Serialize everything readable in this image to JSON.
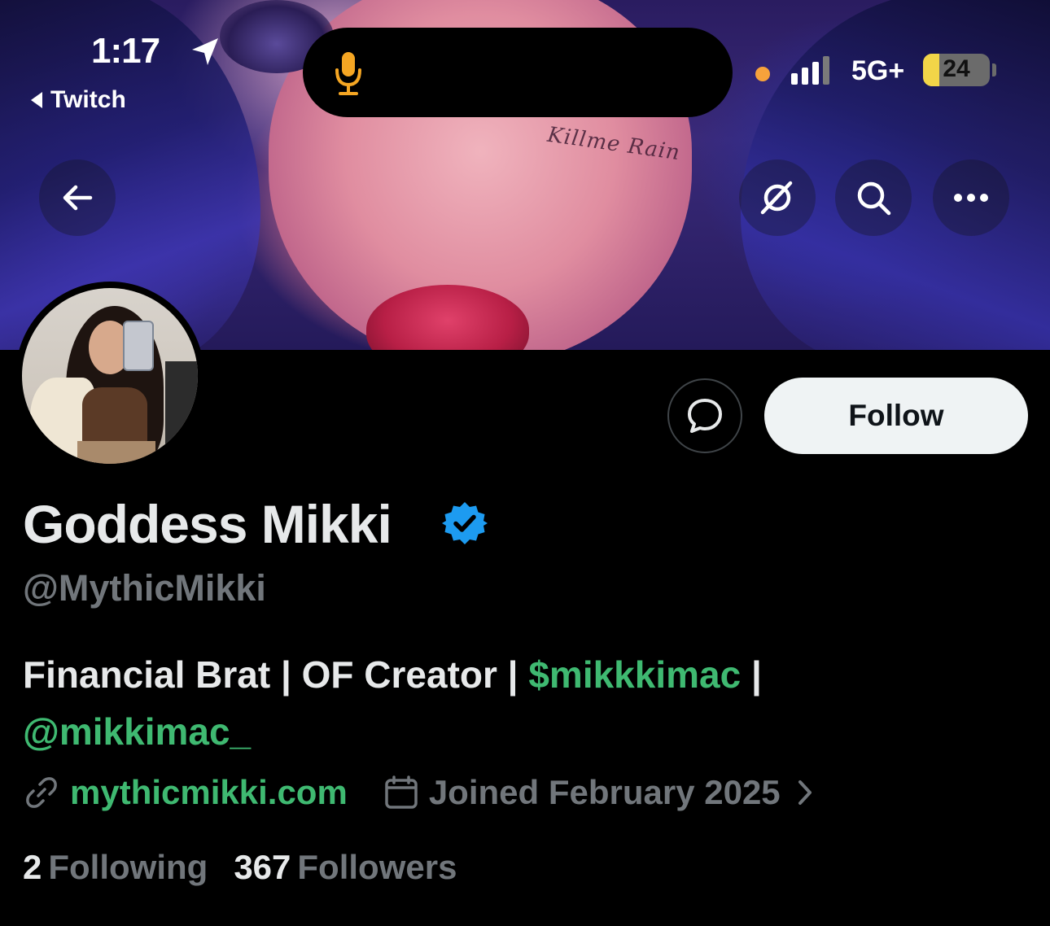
{
  "status_bar": {
    "time": "1:17",
    "back_app": "Twitch",
    "network": "5G+",
    "battery_level": "24",
    "battery_fraction": 0.24,
    "signal_bars_filled": 3,
    "icons": [
      "location-arrow-icon",
      "mic-icon",
      "privacy-dot-icon",
      "signal-icon",
      "battery-icon"
    ]
  },
  "nav": {
    "icons": [
      "back-arrow-icon",
      "grok-icon",
      "search-icon",
      "more-icon"
    ]
  },
  "actions": {
    "message_icon": "message-bubble-icon",
    "follow_label": "Follow"
  },
  "profile": {
    "display_name": "Goddess Mikki",
    "verified_icon": "verified-badge-icon",
    "handle": "@MythicMikki",
    "bio": {
      "text_1": "Financial Brat | OF Creator | ",
      "link_1": "$mikkkimac",
      "text_2": " |",
      "link_2": "@mikkimac_"
    },
    "website": "mythicmikki.com",
    "joined": "Joined February 2025",
    "following_count": "2",
    "following_label": "Following",
    "followers_count": "367",
    "followers_label": "Followers"
  },
  "colors": {
    "background": "#000000",
    "primary_text": "#e7e9ea",
    "secondary_text": "#71767b",
    "link_green": "#3fb971",
    "verified_blue": "#1d9bf0",
    "follow_button_bg": "#eff3f4",
    "battery_yellow": "#f2d548",
    "privacy_dot": "#f7a23b"
  }
}
